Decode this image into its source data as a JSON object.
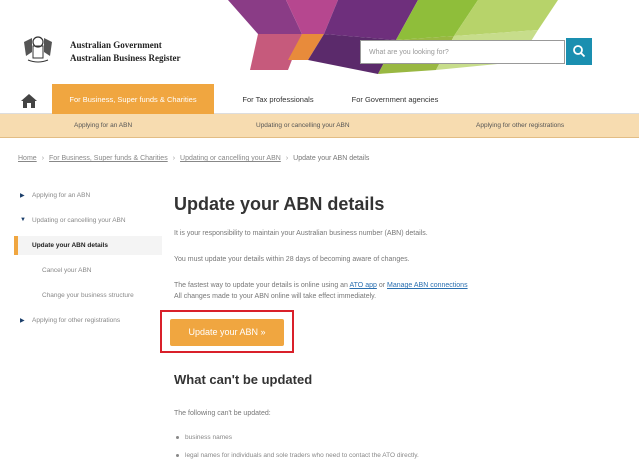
{
  "header": {
    "gov_line1": "Australian Government",
    "gov_line2": "Australian Business Register",
    "search_placeholder": "What are you looking for?",
    "search_icon": "search-icon",
    "crest_icon": "coat-of-arms-icon"
  },
  "nav": {
    "home_icon": "home-icon",
    "tabs": [
      "For Business, Super funds & Charities",
      "For Tax professionals",
      "For Government agencies"
    ],
    "subnav": [
      "Applying for an ABN",
      "Updating or cancelling your ABN",
      "Applying for other registrations"
    ]
  },
  "breadcrumb": {
    "items": [
      "Home",
      "For Business, Super funds & Charities",
      "Updating or cancelling your ABN",
      "Update your ABN details"
    ]
  },
  "sidebar": {
    "items": [
      "Applying for an ABN",
      "Updating or cancelling your ABN",
      "Update your ABN details",
      "Cancel your ABN",
      "Change your business structure",
      "Applying for other registrations"
    ]
  },
  "main": {
    "title": "Update your ABN details",
    "para1": "It is your responsibility to maintain your Australian business number (ABN) details.",
    "para2": "You must update your details within 28 days of becoming aware of changes.",
    "para3_prefix": "The fastest way to update your details is online using an",
    "para3_link1": "ATO app",
    "para3_or": "or",
    "para3_link2": "Manage ABN connections",
    "para3_suffix": "All changes made to your ABN online will take effect immediately.",
    "cta_label": "Update your ABN »",
    "section_title": "What can't be updated",
    "section_intro": "The following can't be updated:",
    "bullets": [
      "business names",
      "legal names for individuals and sole traders who need to contact the ATO directly."
    ]
  },
  "colors": {
    "accent": "#f0a640",
    "subnav_bg": "#f7dcb0",
    "search_btn": "#1a8fb0",
    "highlight_outline": "#d9202a"
  }
}
